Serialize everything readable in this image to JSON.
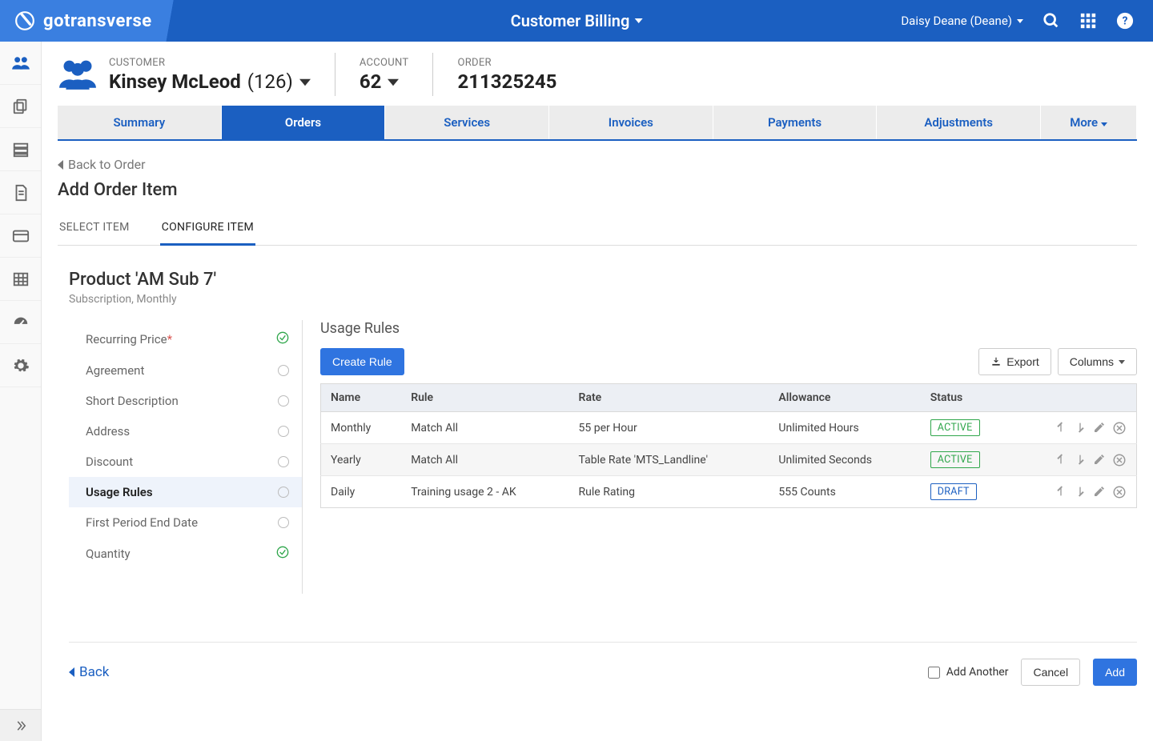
{
  "brand": "gotransverse",
  "header": {
    "section": "Customer Billing",
    "user": "Daisy Deane (Deane)"
  },
  "rail": [
    {
      "name": "customers-icon",
      "active": true
    },
    {
      "name": "copy-icon",
      "active": false
    },
    {
      "name": "server-icon",
      "active": false
    },
    {
      "name": "document-icon",
      "active": false
    },
    {
      "name": "card-icon",
      "active": false
    },
    {
      "name": "table-icon",
      "active": false
    },
    {
      "name": "dashboard-icon",
      "active": false
    },
    {
      "name": "gear-icon",
      "active": false
    }
  ],
  "context": {
    "customer": {
      "label": "CUSTOMER",
      "name": "Kinsey McLeod",
      "id": "(126)"
    },
    "account": {
      "label": "ACCOUNT",
      "value": "62"
    },
    "order": {
      "label": "ORDER",
      "value": "211325245"
    }
  },
  "tabs": [
    "Summary",
    "Orders",
    "Services",
    "Invoices",
    "Payments",
    "Adjustments"
  ],
  "tabs_more": "More",
  "active_tab": "Orders",
  "back_to_order": "Back to Order",
  "page_title": "Add Order Item",
  "subtabs": {
    "select": "SELECT ITEM",
    "configure": "CONFIGURE ITEM",
    "active": "configure"
  },
  "product": {
    "title": "Product 'AM Sub 7'",
    "sub": "Subscription, Monthly"
  },
  "steps": [
    {
      "label": "Recurring Price",
      "required": true,
      "status": "check"
    },
    {
      "label": "Agreement",
      "status": "circle"
    },
    {
      "label": "Short Description",
      "status": "circle"
    },
    {
      "label": "Address",
      "status": "circle"
    },
    {
      "label": "Discount",
      "status": "circle"
    },
    {
      "label": "Usage Rules",
      "status": "circle",
      "active": true
    },
    {
      "label": "First Period End Date",
      "status": "circle"
    },
    {
      "label": "Quantity",
      "status": "check"
    }
  ],
  "panel": {
    "title": "Usage Rules",
    "create": "Create Rule",
    "export": "Export",
    "columns": "Columns",
    "headers": [
      "Name",
      "Rule",
      "Rate",
      "Allowance",
      "Status"
    ],
    "rows": [
      {
        "name": "Monthly",
        "rule": "Match All",
        "rate": "55 per Hour",
        "allowance": "Unlimited Hours",
        "status": "ACTIVE",
        "status_kind": "active"
      },
      {
        "name": "Yearly",
        "rule": "Match All",
        "rate": "Table Rate 'MTS_Landline'",
        "allowance": "Unlimited Seconds",
        "status": "ACTIVE",
        "status_kind": "active"
      },
      {
        "name": "Daily",
        "rule": "Training usage 2 - AK",
        "rate": "Rule Rating",
        "allowance": "555 Counts",
        "status": "DRAFT",
        "status_kind": "draft"
      }
    ]
  },
  "footer": {
    "back": "Back",
    "add_another": "Add Another",
    "cancel": "Cancel",
    "add": "Add"
  }
}
